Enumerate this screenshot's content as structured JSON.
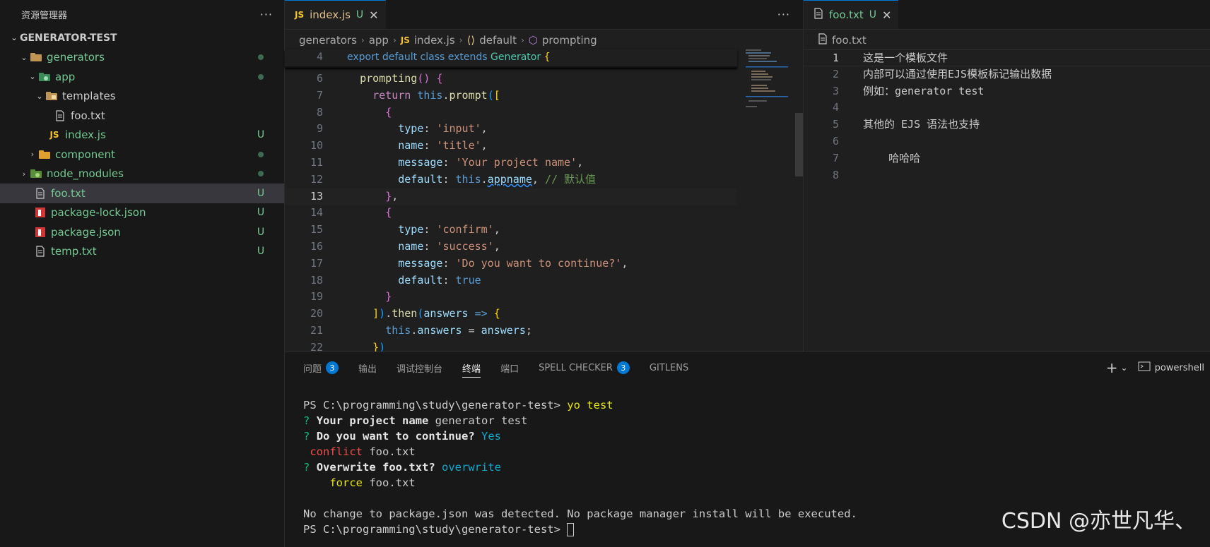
{
  "sidebar": {
    "title": "资源管理器",
    "more": "···",
    "root": "GENERATOR-TEST",
    "items": [
      {
        "label": "generators",
        "badge": "●"
      },
      {
        "label": "app",
        "badge": "●"
      },
      {
        "label": "templates",
        "badge": ""
      },
      {
        "label": "foo.txt",
        "badge": ""
      },
      {
        "label": "index.js",
        "badge": "U",
        "icon_text": "JS"
      },
      {
        "label": "component",
        "badge": "●"
      },
      {
        "label": "node_modules",
        "badge": "●"
      },
      {
        "label": "foo.txt",
        "badge": "U"
      },
      {
        "label": "package-lock.json",
        "badge": "U"
      },
      {
        "label": "package.json",
        "badge": "U"
      },
      {
        "label": "temp.txt",
        "badge": "U"
      }
    ]
  },
  "editor1": {
    "tab": {
      "icon_text": "JS",
      "name": "index.js",
      "state": "U",
      "close": "✕"
    },
    "more": "···",
    "breadcrumb": {
      "p1": "generators",
      "p2": "app",
      "js": "JS",
      "p3": "index.js",
      "p4": "default",
      "p5": "prompting"
    },
    "lines": [
      {
        "n": "4",
        "t": "sticky"
      },
      {
        "n": "6"
      },
      {
        "n": "7"
      },
      {
        "n": "8"
      },
      {
        "n": "9"
      },
      {
        "n": "10"
      },
      {
        "n": "11"
      },
      {
        "n": "12"
      },
      {
        "n": "13"
      },
      {
        "n": "14"
      },
      {
        "n": "15"
      },
      {
        "n": "16"
      },
      {
        "n": "17"
      },
      {
        "n": "18"
      },
      {
        "n": "19"
      },
      {
        "n": "20"
      },
      {
        "n": "21"
      },
      {
        "n": "22"
      }
    ],
    "code": {
      "export": "export",
      "default": "default",
      "class": "class",
      "extends": "extends",
      "generator": "Generator",
      "prompting": "prompting",
      "return": "return",
      "this": "this",
      "prompt": "prompt",
      "type": "type",
      "name": "name",
      "message": "message",
      "default_key": "default",
      "input": "'input'",
      "title": "'title'",
      "your_project": "'Your project name'",
      "appname": "appname",
      "comment": "// 默认值",
      "confirm": "'confirm'",
      "success": "'success'",
      "continue": "'Do you want to continue?'",
      "true": "true",
      "then": "then",
      "answers": "answers",
      "arrow": "=>"
    }
  },
  "editor2": {
    "tab": {
      "name": "foo.txt",
      "state": "U",
      "close": "✕"
    },
    "breadcrumb": "foo.txt",
    "lines": [
      {
        "n": "1",
        "t": "这是一个模板文件"
      },
      {
        "n": "2",
        "t": "内部可以通过使用EJS模板标记输出数据"
      },
      {
        "n": "3",
        "t": "例如：generator test"
      },
      {
        "n": "4",
        "t": ""
      },
      {
        "n": "5",
        "t": "其他的 EJS 语法也支持"
      },
      {
        "n": "6",
        "t": ""
      },
      {
        "n": "7",
        "t": "    哈哈哈"
      },
      {
        "n": "8",
        "t": ""
      }
    ]
  },
  "panel": {
    "tabs": {
      "problems": "问题",
      "problems_count": "3",
      "output": "输出",
      "debug": "调试控制台",
      "terminal": "终端",
      "ports": "端口",
      "spell": "SPELL CHECKER",
      "spell_count": "3",
      "gitlens": "GITLENS"
    },
    "tools": {
      "add": "+",
      "dropdown": "⌄",
      "shell": "powershell"
    },
    "terminal": {
      "prompt": "PS C:\\programming\\study\\generator-test>",
      "cmd": "yo test",
      "q1_mark": "?",
      "q1": "Your project name",
      "a1": "generator test",
      "q2_mark": "?",
      "q2": "Do you want to continue?",
      "a2": "Yes",
      "conflict": "conflict",
      "conflict_file": "foo.txt",
      "q3_mark": "?",
      "q3": "Overwrite foo.txt?",
      "a3": "overwrite",
      "force": "force",
      "force_file": "foo.txt",
      "nochange": "No change to package.json was detected. No package manager install will be executed.",
      "prompt2": "PS C:\\programming\\study\\generator-test>"
    }
  },
  "watermark": "CSDN @亦世凡华、"
}
